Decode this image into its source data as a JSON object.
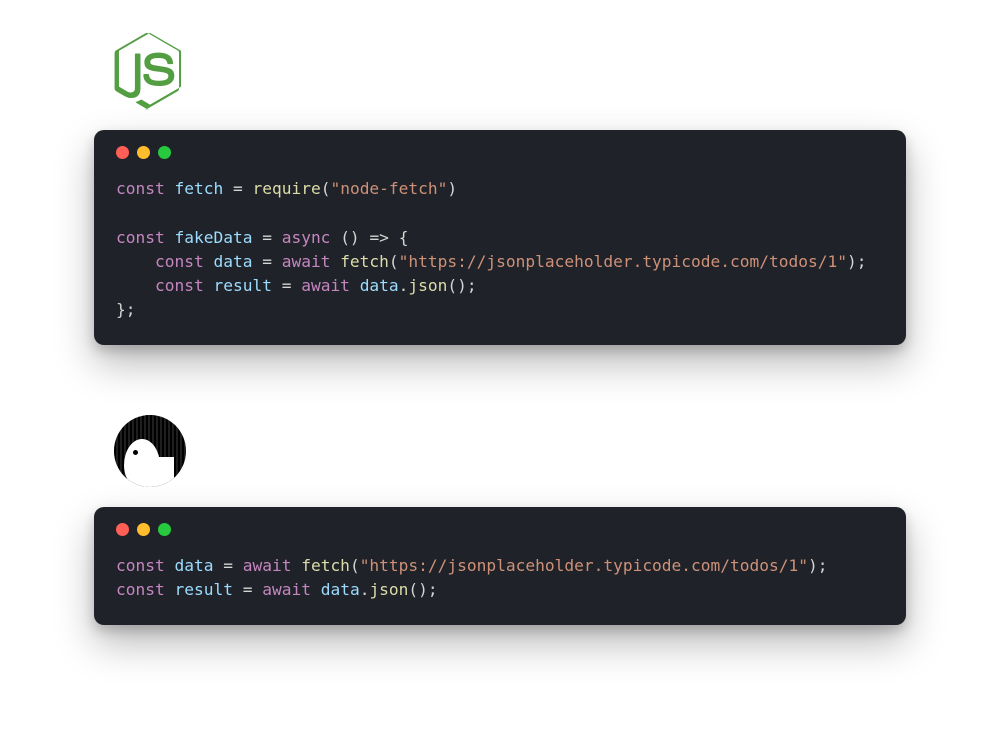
{
  "colors": {
    "background": "#1f2228",
    "traffic_red": "#ff5f56",
    "traffic_yellow": "#ffbd2e",
    "traffic_green": "#27c93f",
    "token_keyword": "#c586c0",
    "token_variable": "#9cdcfe",
    "token_function": "#dcdcaa",
    "token_string": "#ce9178",
    "token_punct": "#d4d4d4"
  },
  "snippets": [
    {
      "runtime": "node",
      "lines": [
        [
          {
            "t": "keyword",
            "v": "const"
          },
          {
            "t": "space",
            "v": " "
          },
          {
            "t": "var",
            "v": "fetch"
          },
          {
            "t": "space",
            "v": " "
          },
          {
            "t": "punc",
            "v": "="
          },
          {
            "t": "space",
            "v": " "
          },
          {
            "t": "func",
            "v": "require"
          },
          {
            "t": "punc",
            "v": "("
          },
          {
            "t": "string",
            "v": "\"node-fetch\""
          },
          {
            "t": "punc",
            "v": ")"
          }
        ],
        [],
        [
          {
            "t": "keyword",
            "v": "const"
          },
          {
            "t": "space",
            "v": " "
          },
          {
            "t": "var",
            "v": "fakeData"
          },
          {
            "t": "space",
            "v": " "
          },
          {
            "t": "punc",
            "v": "="
          },
          {
            "t": "space",
            "v": " "
          },
          {
            "t": "keyword",
            "v": "async"
          },
          {
            "t": "space",
            "v": " "
          },
          {
            "t": "punc",
            "v": "()"
          },
          {
            "t": "space",
            "v": " "
          },
          {
            "t": "punc",
            "v": "=>"
          },
          {
            "t": "space",
            "v": " "
          },
          {
            "t": "punc",
            "v": "{"
          }
        ],
        [
          {
            "t": "space",
            "v": "    "
          },
          {
            "t": "keyword",
            "v": "const"
          },
          {
            "t": "space",
            "v": " "
          },
          {
            "t": "var",
            "v": "data"
          },
          {
            "t": "space",
            "v": " "
          },
          {
            "t": "punc",
            "v": "="
          },
          {
            "t": "space",
            "v": " "
          },
          {
            "t": "keyword",
            "v": "await"
          },
          {
            "t": "space",
            "v": " "
          },
          {
            "t": "func",
            "v": "fetch"
          },
          {
            "t": "punc",
            "v": "("
          },
          {
            "t": "string",
            "v": "\"https://jsonplaceholder.typicode.com/todos/1\""
          },
          {
            "t": "punc",
            "v": ");"
          }
        ],
        [
          {
            "t": "space",
            "v": "    "
          },
          {
            "t": "keyword",
            "v": "const"
          },
          {
            "t": "space",
            "v": " "
          },
          {
            "t": "var",
            "v": "result"
          },
          {
            "t": "space",
            "v": " "
          },
          {
            "t": "punc",
            "v": "="
          },
          {
            "t": "space",
            "v": " "
          },
          {
            "t": "keyword",
            "v": "await"
          },
          {
            "t": "space",
            "v": " "
          },
          {
            "t": "var",
            "v": "data"
          },
          {
            "t": "punc",
            "v": "."
          },
          {
            "t": "func",
            "v": "json"
          },
          {
            "t": "punc",
            "v": "();"
          }
        ],
        [
          {
            "t": "punc",
            "v": "};"
          }
        ]
      ]
    },
    {
      "runtime": "deno",
      "lines": [
        [
          {
            "t": "keyword",
            "v": "const"
          },
          {
            "t": "space",
            "v": " "
          },
          {
            "t": "var",
            "v": "data"
          },
          {
            "t": "space",
            "v": " "
          },
          {
            "t": "punc",
            "v": "="
          },
          {
            "t": "space",
            "v": " "
          },
          {
            "t": "keyword",
            "v": "await"
          },
          {
            "t": "space",
            "v": " "
          },
          {
            "t": "func",
            "v": "fetch"
          },
          {
            "t": "punc",
            "v": "("
          },
          {
            "t": "string",
            "v": "\"https://jsonplaceholder.typicode.com/todos/1\""
          },
          {
            "t": "punc",
            "v": ");"
          }
        ],
        [
          {
            "t": "keyword",
            "v": "const"
          },
          {
            "t": "space",
            "v": " "
          },
          {
            "t": "var",
            "v": "result"
          },
          {
            "t": "space",
            "v": " "
          },
          {
            "t": "punc",
            "v": "="
          },
          {
            "t": "space",
            "v": " "
          },
          {
            "t": "keyword",
            "v": "await"
          },
          {
            "t": "space",
            "v": " "
          },
          {
            "t": "var",
            "v": "data"
          },
          {
            "t": "punc",
            "v": "."
          },
          {
            "t": "func",
            "v": "json"
          },
          {
            "t": "punc",
            "v": "();"
          }
        ]
      ]
    }
  ]
}
